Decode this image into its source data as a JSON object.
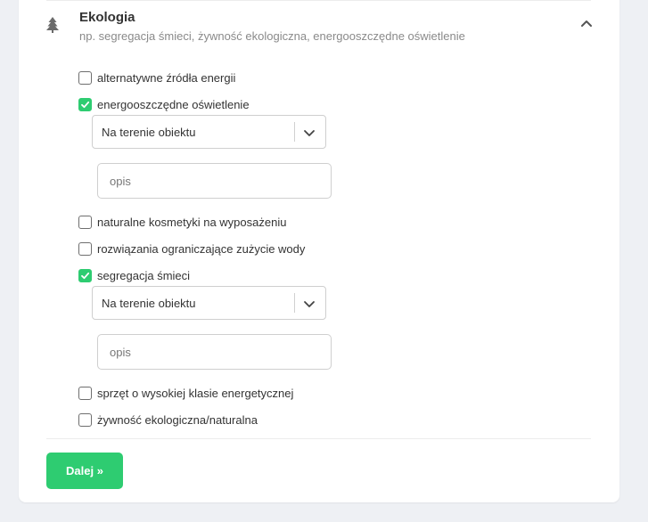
{
  "section": {
    "title": "Ekologia",
    "subtitle": "np. segregacja śmieci, żywność ekologiczna, energooszczędne oświetlenie",
    "icon": "tree-icon",
    "toggle_icon": "chevron-up-icon"
  },
  "items": [
    {
      "label": "alternatywne źródła energii",
      "checked": false
    },
    {
      "label": "energooszczędne oświetlenie",
      "checked": true,
      "select_value": "Na terenie obiektu",
      "description_placeholder": "opis"
    },
    {
      "label": "naturalne kosmetyki na wyposażeniu",
      "checked": false
    },
    {
      "label": "rozwiązania ograniczające zużycie wody",
      "checked": false
    },
    {
      "label": "segregacja śmieci",
      "checked": true,
      "select_value": "Na terenie obiektu",
      "description_placeholder": "opis"
    },
    {
      "label": "sprzęt o wysokiej klasie energetycznej",
      "checked": false
    },
    {
      "label": "żywność ekologiczna/naturalna",
      "checked": false
    }
  ],
  "footer": {
    "next_label": "Dalej »"
  },
  "colors": {
    "accent": "#2ecc71",
    "border": "#cfcfcf",
    "muted_text": "#8a8a8a"
  }
}
